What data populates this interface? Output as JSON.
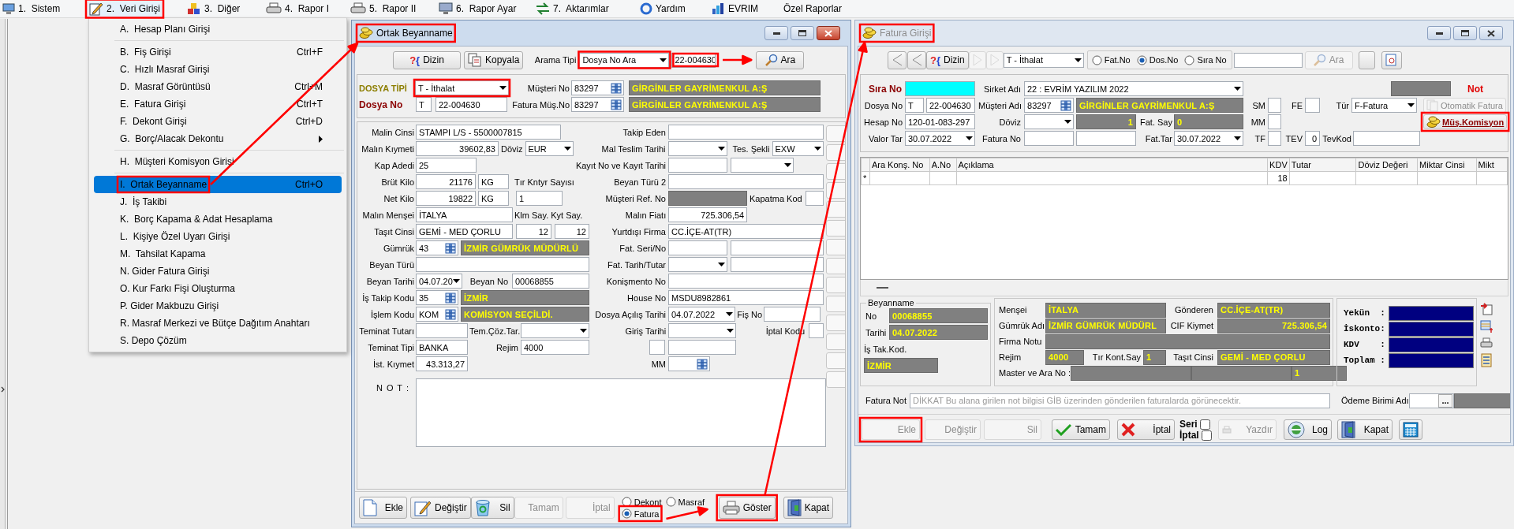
{
  "menu_bar": {
    "items": [
      {
        "label": "1.  Sistem",
        "selected": false
      },
      {
        "label": "2.  Veri Girişi",
        "selected": true
      },
      {
        "label": "3.  Diğer",
        "selected": false
      },
      {
        "label": "4.  Rapor I",
        "selected": false
      },
      {
        "label": "5.  Rapor II",
        "selected": false
      },
      {
        "label": "6.  Rapor Ayar",
        "selected": false
      },
      {
        "label": "7.  Aktarımlar",
        "selected": false
      },
      {
        "label": "Yardım",
        "selected": false
      },
      {
        "label": "EVRIM",
        "selected": false
      },
      {
        "label": "Özel Raporlar",
        "selected": false
      }
    ]
  },
  "dropdown_menu": {
    "groups": [
      {
        "items": [
          {
            "kind": "item",
            "label": "A.  Hesap Planı Girişi",
            "selected": false
          }
        ]
      },
      {
        "items": [
          {
            "kind": "item",
            "label": "B.  Fiş Girişi",
            "shortcut": "Ctrl+F",
            "selected": false
          },
          {
            "kind": "item",
            "label": "C.  Hızlı Masraf Girişi",
            "selected": false
          },
          {
            "kind": "item",
            "label": "D.  Masraf Görüntüsü",
            "shortcut": "Ctrl+M",
            "selected": false
          },
          {
            "kind": "item",
            "label": "E.  Fatura Girişi",
            "shortcut": "Ctrl+T",
            "selected": false
          },
          {
            "kind": "item",
            "label": "F.  Dekont Girişi",
            "shortcut": "Ctrl+D",
            "selected": false
          },
          {
            "kind": "submenu",
            "label": "G.  Borç/Alacak Dekontu",
            "selected": false
          }
        ]
      },
      {
        "items": [
          {
            "kind": "item",
            "label": "H.  Müşteri Komisyon Girişi",
            "selected": false
          }
        ]
      },
      {
        "items": [
          {
            "kind": "item",
            "label": "I.  Ortak Beyanname",
            "shortcut": "Ctrl+O",
            "selected": true
          },
          {
            "kind": "item",
            "label": "J.  İş Takibi",
            "selected": false
          },
          {
            "kind": "item",
            "label": "K.  Borç Kapama & Adat Hesaplama",
            "selected": false
          },
          {
            "kind": "item",
            "label": "L.  Kişiye Özel Uyarı Girişi",
            "selected": false
          },
          {
            "kind": "item",
            "label": "M.  Tahsilat Kapama",
            "selected": false
          },
          {
            "kind": "item",
            "label": "N. Gider Fatura Girişi",
            "selected": false
          },
          {
            "kind": "item",
            "label": "O. Kur Farkı Fişi Oluşturma",
            "selected": false
          },
          {
            "kind": "item",
            "label": "P. Gider Makbuzu Girişi",
            "selected": false
          },
          {
            "kind": "item",
            "label": "R. Masraf Merkezi ve Bütçe Dağıtım Anahtarı",
            "selected": false
          },
          {
            "kind": "item",
            "label": "S. Depo Çözüm",
            "selected": false
          }
        ]
      }
    ]
  },
  "ortak_beyanname": {
    "title": "Ortak Beyanname",
    "active": true,
    "toolbar": {
      "items": [
        {
          "kind": "button",
          "glyph": "?{",
          "label": "Dizin",
          "disabled": false
        },
        {
          "kind": "button",
          "label": "Kopyala",
          "disabled": false
        },
        {
          "kind": "label",
          "text": "Arama Tipi"
        },
        {
          "kind": "select",
          "value": "Dosya No Ara"
        },
        {
          "kind": "input",
          "value": "22-004630"
        },
        {
          "kind": "button",
          "label": "Ara",
          "disabled": false
        }
      ]
    },
    "header": {
      "lines": [
        {
          "fields": [
            {
              "kind": "type_label",
              "text": "DOSYA TİPİ"
            },
            {
              "kind": "select",
              "value": "T - İthalat"
            },
            {
              "kind": "label",
              "text": "Müşteri No"
            },
            {
              "kind": "lookup",
              "value": "83297"
            },
            {
              "kind": "display",
              "value": "GİRGİNLER GAYRİMENKUL A:Ş"
            }
          ]
        },
        {
          "fields": [
            {
              "kind": "key_label",
              "text": "Dosya No"
            },
            {
              "kind": "input",
              "value": "T"
            },
            {
              "kind": "input",
              "value": "22-004630"
            },
            {
              "kind": "label",
              "text": "Fatura Müş.No"
            },
            {
              "kind": "lookup",
              "value": "83297"
            },
            {
              "kind": "display",
              "value": "GİRGİNLER GAYRİMENKUL A:Ş"
            }
          ]
        }
      ]
    },
    "form": {
      "lines": [
        {
          "fields": [
            {
              "kind": "label",
              "text": "Malin Cinsi"
            },
            {
              "kind": "input",
              "value": "STAMPI L/S  - 5500007815"
            },
            {
              "kind": "label",
              "text": "Takip Eden"
            },
            {
              "kind": "input"
            }
          ]
        },
        {
          "fields": [
            {
              "kind": "label",
              "text": "Malın Kıymeti"
            },
            {
              "kind": "number",
              "value": "39602,83"
            },
            {
              "kind": "label",
              "text": "Döviz"
            },
            {
              "kind": "select",
              "value": "EUR"
            },
            {
              "kind": "label",
              "text": "Mal Teslim Tarihi"
            },
            {
              "kind": "select"
            },
            {
              "kind": "label",
              "text": "Tes. Şekli"
            },
            {
              "kind": "select",
              "value": "EXW"
            }
          ]
        },
        {
          "fields": [
            {
              "kind": "label",
              "text": "Kap Adedi"
            },
            {
              "kind": "input",
              "value": "25"
            },
            {
              "kind": "label",
              "text": "Kayıt  No  ve Kayıt Tarihi"
            },
            {
              "kind": "input"
            },
            {
              "kind": "select"
            }
          ]
        },
        {
          "fields": [
            {
              "kind": "label",
              "text": "Brüt Kilo"
            },
            {
              "kind": "number",
              "value": "21176"
            },
            {
              "kind": "input",
              "value": "KG"
            },
            {
              "kind": "label",
              "text": "Tır Kntyr Sayısı"
            },
            {
              "kind": "label",
              "text": "Beyan Türü 2"
            },
            {
              "kind": "input"
            }
          ]
        },
        {
          "fields": [
            {
              "kind": "label",
              "text": "Net Kilo"
            },
            {
              "kind": "number",
              "value": "19822"
            },
            {
              "kind": "input",
              "value": "KG"
            },
            {
              "kind": "input",
              "value": "1"
            },
            {
              "kind": "label",
              "text": "Müşteri  Ref. No"
            },
            {
              "kind": "shade"
            },
            {
              "kind": "label",
              "text": "Kapatma Kod"
            },
            {
              "kind": "input"
            }
          ]
        },
        {
          "fields": [
            {
              "kind": "label",
              "text": "Malın Menşei"
            },
            {
              "kind": "input",
              "value": "İTALYA"
            },
            {
              "kind": "label",
              "text": "Klm Say."
            },
            {
              "kind": "label",
              "text": "Kyt Say."
            },
            {
              "kind": "label",
              "text": "Malın Fiatı"
            },
            {
              "kind": "number",
              "value": "725.306,54"
            }
          ]
        },
        {
          "fields": [
            {
              "kind": "label",
              "text": "Taşıt Cinsi"
            },
            {
              "kind": "input",
              "value": "GEMİ - MED ÇORLU"
            },
            {
              "kind": "number",
              "value": "12"
            },
            {
              "kind": "number",
              "value": "12"
            },
            {
              "kind": "label",
              "text": "Yurtdışı Firma"
            },
            {
              "kind": "input",
              "value": "CC.İÇE-AT(TR)"
            }
          ]
        },
        {
          "fields": [
            {
              "kind": "label",
              "text": "Gümrük"
            },
            {
              "kind": "lookup",
              "value": "43"
            },
            {
              "kind": "display",
              "value": "İZMİR GÜMRÜK MÜDÜRLÜ"
            },
            {
              "kind": "label",
              "text": "Fat. Seri/No"
            },
            {
              "kind": "input"
            },
            {
              "kind": "input"
            }
          ]
        },
        {
          "fields": [
            {
              "kind": "label",
              "text": "Beyan Türü"
            },
            {
              "kind": "input"
            },
            {
              "kind": "label",
              "text": "Fat. Tarih/Tutar"
            },
            {
              "kind": "select"
            },
            {
              "kind": "input"
            }
          ]
        },
        {
          "fields": [
            {
              "kind": "label",
              "text": "Beyan Tarihi"
            },
            {
              "kind": "select",
              "value": "04.07.20"
            },
            {
              "kind": "label",
              "text": "Beyan No"
            },
            {
              "kind": "input",
              "value": "00068855"
            },
            {
              "kind": "label",
              "text": "Konişmento No"
            },
            {
              "kind": "input"
            }
          ]
        },
        {
          "fields": [
            {
              "kind": "label",
              "text": "İş Takip Kodu"
            },
            {
              "kind": "lookup",
              "value": "35"
            },
            {
              "kind": "display",
              "value": "İZMİR"
            },
            {
              "kind": "label",
              "text": "House No"
            },
            {
              "kind": "input",
              "value": "MSDU8982861"
            }
          ]
        },
        {
          "fields": [
            {
              "kind": "label",
              "text": "İşlem Kodu"
            },
            {
              "kind": "lookup",
              "value": "KOM"
            },
            {
              "kind": "display",
              "value": "KOMİSYON SEÇİLDİ."
            },
            {
              "kind": "label",
              "text": "Dosya Açılış Tarihi"
            },
            {
              "kind": "select",
              "value": "04.07.2022"
            },
            {
              "kind": "label",
              "text": "Fiş No"
            },
            {
              "kind": "input"
            }
          ]
        },
        {
          "fields": [
            {
              "kind": "label",
              "text": "Teminat Tutarı"
            },
            {
              "kind": "input"
            },
            {
              "kind": "label",
              "text": "Tem.Çöz.Tar."
            },
            {
              "kind": "select"
            },
            {
              "kind": "label",
              "text": "Giriş Tarihi"
            },
            {
              "kind": "select"
            },
            {
              "kind": "label",
              "text": "İptal Kodu"
            },
            {
              "kind": "input"
            }
          ]
        },
        {
          "fields": [
            {
              "kind": "label",
              "text": "Teminat Tipi"
            },
            {
              "kind": "input",
              "value": "BANKA"
            },
            {
              "kind": "label",
              "text": "Rejim"
            },
            {
              "kind": "input",
              "value": "4000"
            },
            {
              "kind": "input"
            },
            {
              "kind": "input"
            }
          ]
        },
        {
          "fields": [
            {
              "kind": "label",
              "text": "İst. Kıymet"
            },
            {
              "kind": "number",
              "value": "43.313,27"
            },
            {
              "kind": "label",
              "text": "MM"
            },
            {
              "kind": "lookup"
            }
          ]
        }
      ],
      "note": {
        "label": "N O T :"
      }
    },
    "buttons": {
      "items": [
        {
          "kind": "button",
          "label": "Ekle",
          "disabled": false
        },
        {
          "kind": "button",
          "label": "Değiştir",
          "disabled": false
        },
        {
          "kind": "button",
          "label": "Sil",
          "disabled": false
        },
        {
          "kind": "button",
          "label": "Tamam",
          "disabled": true
        },
        {
          "kind": "button",
          "label": "İptal",
          "disabled": true
        },
        {
          "kind": "radio_group",
          "options": [
            {
              "label": "Dekont",
              "selected": false
            },
            {
              "label": "Masraf",
              "selected": false
            },
            {
              "label": "Fatura",
              "selected": true
            }
          ]
        },
        {
          "kind": "button",
          "label": "Göster",
          "disabled": false
        },
        {
          "kind": "button",
          "label": "Kapat",
          "disabled": false
        }
      ]
    }
  },
  "fatura_girisi": {
    "title": "Fatura Girişi",
    "active": false,
    "toolbar": {
      "items": [
        {
          "kind": "icon_button",
          "disabled": false
        },
        {
          "kind": "icon_button",
          "disabled": false
        },
        {
          "kind": "button",
          "glyph": "?{",
          "label": "Dizin",
          "disabled": false
        },
        {
          "kind": "icon_button",
          "disabled": true
        },
        {
          "kind": "icon_button",
          "disabled": true
        },
        {
          "kind": "select",
          "value": "T - İthalat"
        },
        {
          "kind": "radio_box",
          "options": [
            {
              "label": "Fat.No",
              "selected": false
            },
            {
              "label": "Dos.No",
              "selected": true
            },
            {
              "label": "Sıra No",
              "selected": false
            }
          ]
        },
        {
          "kind": "input"
        },
        {
          "kind": "button",
          "label": "Ara",
          "disabled": true
        },
        {
          "kind": "icon_button",
          "disabled": false
        },
        {
          "kind": "icon_button",
          "disabled": false
        }
      ]
    },
    "header": {
      "lines": [
        {
          "fields": [
            {
              "kind": "key_label",
              "text": "Sıra No"
            },
            {
              "kind": "key_input"
            },
            {
              "kind": "label",
              "text": "Sirket Adı"
            },
            {
              "kind": "select",
              "value": "22 : EVRİM YAZILIM  2022"
            },
            {
              "kind": "shade"
            },
            {
              "kind": "alert_label",
              "text": "Not"
            }
          ]
        },
        {
          "fields": [
            {
              "kind": "label",
              "text": "Dosya No"
            },
            {
              "kind": "input",
              "value": "T"
            },
            {
              "kind": "input",
              "value": "22-004630"
            },
            {
              "kind": "label",
              "text": "Müşteri Adı"
            },
            {
              "kind": "lookup",
              "value": "83297"
            },
            {
              "kind": "display",
              "value": "GİRGİNLER GAYRİMENKUL A:Ş"
            },
            {
              "kind": "label",
              "text": "SM"
            },
            {
              "kind": "input"
            },
            {
              "kind": "label",
              "text": "FE"
            },
            {
              "kind": "input"
            },
            {
              "kind": "label",
              "text": "Tür"
            },
            {
              "kind": "select",
              "value": "F-Fatura"
            },
            {
              "kind": "button",
              "label": "Otomatik Fatura",
              "disabled": true
            }
          ]
        },
        {
          "fields": [
            {
              "kind": "label",
              "text": "Hesap No"
            },
            {
              "kind": "input",
              "value": "120-01-083-297"
            },
            {
              "kind": "label",
              "text": "Döviz"
            },
            {
              "kind": "select"
            },
            {
              "kind": "display_number",
              "value": "1"
            },
            {
              "kind": "label",
              "text": "Fat. Say"
            },
            {
              "kind": "display",
              "value": "0"
            },
            {
              "kind": "label",
              "text": "MM"
            },
            {
              "kind": "input"
            },
            {
              "kind": "accent_button",
              "label": "Müş.Komisyon",
              "disabled": false
            }
          ]
        },
        {
          "fields": [
            {
              "kind": "label",
              "text": "Valor Tar"
            },
            {
              "kind": "select",
              "value": "30.07.2022"
            },
            {
              "kind": "label",
              "text": "Fatura No"
            },
            {
              "kind": "input"
            },
            {
              "kind": "input"
            },
            {
              "kind": "label",
              "text": "Fat.Tar"
            },
            {
              "kind": "select",
              "value": "30.07.2022"
            },
            {
              "kind": "label",
              "text": "TF"
            },
            {
              "kind": "input"
            },
            {
              "kind": "label",
              "text": "TEV"
            },
            {
              "kind": "number",
              "value": "0"
            },
            {
              "kind": "label",
              "text": "TevKod"
            },
            {
              "kind": "input"
            }
          ]
        }
      ]
    },
    "grid": {
      "columns": [
        "Ara Konş. No",
        "A.No",
        "Açıklama",
        "KDV",
        "Tutar",
        "Döviz Değeri",
        "Miktar Cinsi",
        "Mikt"
      ],
      "rows": [
        {
          "marker": "*",
          "cells": [
            {},
            {},
            {},
            {
              "value": "18"
            },
            {},
            {},
            {},
            {}
          ]
        }
      ]
    },
    "beyanname": {
      "title": "Beyanname",
      "lines": [
        {
          "fields": [
            {
              "kind": "label",
              "text": "No"
            },
            {
              "kind": "display",
              "value": "00068855"
            }
          ]
        },
        {
          "fields": [
            {
              "kind": "label",
              "text": "Tarihi"
            },
            {
              "kind": "display",
              "value": "04.07.2022"
            }
          ]
        },
        {
          "fields": [
            {
              "kind": "label",
              "text": "İş Tak.Kod."
            }
          ]
        },
        {
          "fields": [
            {
              "kind": "display",
              "value": "İZMİR"
            }
          ]
        }
      ]
    },
    "details": {
      "lines": [
        {
          "fields": [
            {
              "kind": "label",
              "text": "Menşei"
            },
            {
              "kind": "display",
              "value": "İTALYA"
            },
            {
              "kind": "label",
              "text": "Gönderen"
            },
            {
              "kind": "display",
              "value": "CC.İÇE-AT(TR)"
            }
          ]
        },
        {
          "fields": [
            {
              "kind": "label",
              "text": "Gümrük Adı"
            },
            {
              "kind": "display",
              "value": "İZMİR GÜMRÜK MÜDÜRL"
            },
            {
              "kind": "label",
              "text": "CIF Kiymet"
            },
            {
              "kind": "display_number",
              "value": "725.306,54"
            }
          ]
        },
        {
          "fields": [
            {
              "kind": "label",
              "text": "Firma Notu"
            },
            {
              "kind": "shade"
            }
          ]
        },
        {
          "fields": [
            {
              "kind": "label",
              "text": "Rejim"
            },
            {
              "kind": "display",
              "value": "4000"
            },
            {
              "kind": "label",
              "text": "Tır Kont.Say"
            },
            {
              "kind": "display",
              "value": "1"
            },
            {
              "kind": "label",
              "text": "Taşıt Cinsi"
            },
            {
              "kind": "display",
              "value": "GEMİ - MED ÇORLU"
            }
          ]
        },
        {
          "fields": [
            {
              "kind": "stacked_label",
              "text": "Master ve Ara No :"
            },
            {
              "kind": "shade"
            },
            {
              "kind": "shade"
            },
            {
              "kind": "display",
              "value": "1"
            }
          ]
        }
      ]
    },
    "totals": {
      "lines": [
        {
          "fields": [
            {
              "kind": "total_label",
              "text": "Yekün  :"
            },
            {
              "kind": "total_field"
            }
          ]
        },
        {
          "fields": [
            {
              "kind": "total_label",
              "text": "İskonto:"
            },
            {
              "kind": "total_field"
            }
          ]
        },
        {
          "fields": [
            {
              "kind": "total_label",
              "text": "KDV    :"
            },
            {
              "kind": "total_field"
            }
          ]
        },
        {
          "fields": [
            {
              "kind": "total_label",
              "text": "Toplam :"
            },
            {
              "kind": "total_field"
            }
          ]
        }
      ]
    },
    "note_row": {
      "fields": [
        {
          "kind": "label",
          "text": "Fatura Not"
        },
        {
          "kind": "input",
          "placeholder": "DİKKAT Bu alana girilen not bilgisi GİB üzerinden gönderilen faturalarda görünecektir."
        },
        {
          "kind": "stacked_label",
          "text": "Ödeme Birimi Adı"
        },
        {
          "kind": "browse",
          "button": "..."
        },
        {
          "kind": "shade"
        }
      ]
    },
    "buttons": {
      "items": [
        {
          "kind": "button",
          "label": "Ekle",
          "disabled": true
        },
        {
          "kind": "button",
          "label": "Değiştir",
          "disabled": true
        },
        {
          "kind": "button",
          "label": "Sil",
          "disabled": true
        },
        {
          "kind": "button",
          "label": "Tamam",
          "disabled": false
        },
        {
          "kind": "button",
          "label": "İptal",
          "disabled": false
        },
        {
          "kind": "checkbox_group",
          "options": [
            {
              "label": "Seri",
              "checked": false
            },
            {
              "label": "İptal",
              "checked": false
            }
          ]
        },
        {
          "kind": "button",
          "label": "Yazdır",
          "disabled": true
        },
        {
          "kind": "button",
          "label": "Log",
          "disabled": false
        },
        {
          "kind": "button",
          "label": "Kapat",
          "disabled": false
        },
        {
          "kind": "icon_button",
          "disabled": false
        }
      ]
    }
  }
}
